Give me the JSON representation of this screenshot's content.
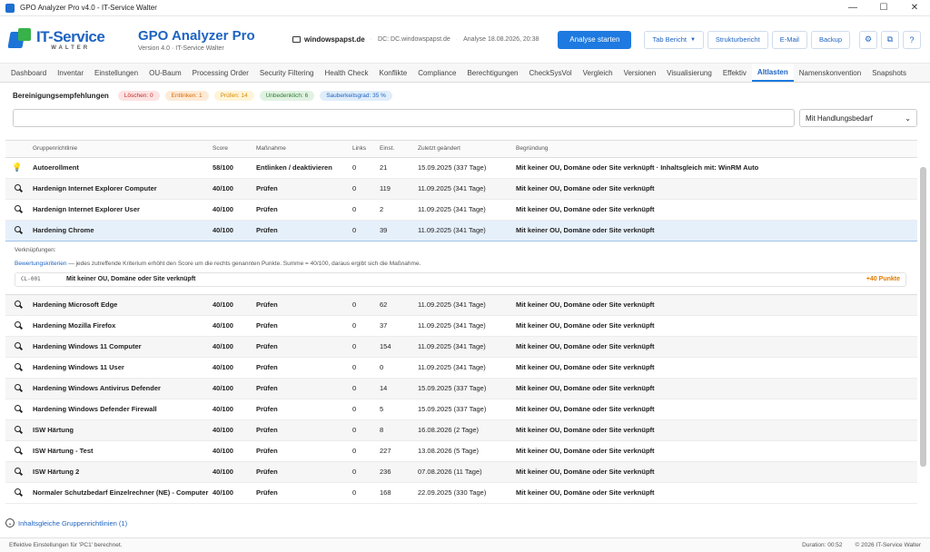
{
  "window": {
    "title": "GPO Analyzer Pro v4.0 - IT-Service Walter",
    "min": "—",
    "max": "☐",
    "close": "✕"
  },
  "brand": {
    "logo_line1": "IT-Service",
    "logo_line2": "WALTER",
    "product": "GPO Analyzer Pro",
    "version": "Version 4.0 · IT-Service Walter"
  },
  "context": {
    "host": "windowspapst.de",
    "dc": "DC: DC.windowspapst.de",
    "analysis": "Analyse 18.08.2026, 20:38"
  },
  "toolbar": {
    "start": "Analyse starten",
    "tab_report": "Tab Bericht",
    "structure": "Strukturbericht",
    "email": "E-Mail",
    "backup": "Backup",
    "help": "?"
  },
  "tabs": [
    "Dashboard",
    "Inventar",
    "Einstellungen",
    "OU-Baum",
    "Processing Order",
    "Security Filtering",
    "Health Check",
    "Konflikte",
    "Compliance",
    "Berechtigungen",
    "CheckSysVol",
    "Vergleich",
    "Versionen",
    "Visualisierung",
    "Effektiv",
    "Altlasten",
    "Namenskonvention",
    "Snapshots"
  ],
  "active_tab": "Altlasten",
  "cleanup": {
    "title": "Bereinigungsempfehlungen",
    "pills": [
      "Löschen: 0",
      "Entlinken: 1",
      "Prüfen: 14",
      "Unbedenklich: 6",
      "Sauberkeitsgrad: 35 %"
    ]
  },
  "filter": {
    "search_value": "",
    "select_value": "Mit Handlungsbedarf"
  },
  "table": {
    "headers": [
      "",
      "Gruppenrichtlinie",
      "Score",
      "Maßnahme",
      "Links",
      "Einst.",
      "Zuletzt geändert",
      "Begründung"
    ],
    "rows": [
      {
        "icon": "bulb",
        "name": "Autoerollment",
        "score": "58/100",
        "action": "Entlinken / deaktivieren",
        "links": "0",
        "settings": "21",
        "changed": "15.09.2025 (337 Tage)",
        "reason": "Mit keiner OU, Domäne oder Site verknüpft · Inhaltsgleich mit: WinRM Auto"
      },
      {
        "icon": "magnifier",
        "name": "Hardenign Internet Explorer Computer",
        "score": "40/100",
        "action": "Prüfen",
        "links": "0",
        "settings": "119",
        "changed": "11.09.2025 (341 Tage)",
        "reason": "Mit keiner OU, Domäne oder Site verknüpft"
      },
      {
        "icon": "magnifier",
        "name": "Hardenign Internet Explorer User",
        "score": "40/100",
        "action": "Prüfen",
        "links": "0",
        "settings": "2",
        "changed": "11.09.2025 (341 Tage)",
        "reason": "Mit keiner OU, Domäne oder Site verknüpft"
      },
      {
        "icon": "magnifier",
        "name": "Hardening Chrome",
        "score": "40/100",
        "action": "Prüfen",
        "links": "0",
        "settings": "39",
        "changed": "11.09.2025 (341 Tage)",
        "reason": "Mit keiner OU, Domäne oder Site verknüpft"
      },
      {
        "icon": "magnifier",
        "name": "Hardening Microsoft Edge",
        "score": "40/100",
        "action": "Prüfen",
        "links": "0",
        "settings": "62",
        "changed": "11.09.2025 (341 Tage)",
        "reason": "Mit keiner OU, Domäne oder Site verknüpft"
      },
      {
        "icon": "magnifier",
        "name": "Hardening Mozilla Firefox",
        "score": "40/100",
        "action": "Prüfen",
        "links": "0",
        "settings": "37",
        "changed": "11.09.2025 (341 Tage)",
        "reason": "Mit keiner OU, Domäne oder Site verknüpft"
      },
      {
        "icon": "magnifier",
        "name": "Hardening Windows 11 Computer",
        "score": "40/100",
        "action": "Prüfen",
        "links": "0",
        "settings": "154",
        "changed": "11.09.2025 (341 Tage)",
        "reason": "Mit keiner OU, Domäne oder Site verknüpft"
      },
      {
        "icon": "magnifier",
        "name": "Hardening Windows 11 User",
        "score": "40/100",
        "action": "Prüfen",
        "links": "0",
        "settings": "0",
        "changed": "11.09.2025 (341 Tage)",
        "reason": "Mit keiner OU, Domäne oder Site verknüpft"
      },
      {
        "icon": "magnifier",
        "name": "Hardening Windows Antivirus Defender",
        "score": "40/100",
        "action": "Prüfen",
        "links": "0",
        "settings": "14",
        "changed": "15.09.2025 (337 Tage)",
        "reason": "Mit keiner OU, Domäne oder Site verknüpft"
      },
      {
        "icon": "magnifier",
        "name": "Hardening Windows Defender Firewall",
        "score": "40/100",
        "action": "Prüfen",
        "links": "0",
        "settings": "5",
        "changed": "15.09.2025 (337 Tage)",
        "reason": "Mit keiner OU, Domäne oder Site verknüpft"
      },
      {
        "icon": "magnifier",
        "name": "ISW Härtung",
        "score": "40/100",
        "action": "Prüfen",
        "links": "0",
        "settings": "8",
        "changed": "16.08.2026 (2 Tage)",
        "reason": "Mit keiner OU, Domäne oder Site verknüpft"
      },
      {
        "icon": "magnifier",
        "name": "ISW Härtung - Test",
        "score": "40/100",
        "action": "Prüfen",
        "links": "0",
        "settings": "227",
        "changed": "13.08.2026 (5 Tage)",
        "reason": "Mit keiner OU, Domäne oder Site verknüpft"
      },
      {
        "icon": "magnifier",
        "name": "ISW Härtung 2",
        "score": "40/100",
        "action": "Prüfen",
        "links": "0",
        "settings": "236",
        "changed": "07.08.2026 (11 Tage)",
        "reason": "Mit keiner OU, Domäne oder Site verknüpft"
      },
      {
        "icon": "magnifier",
        "name": "Normaler Schutzbedarf Einzelrechner (NE) - Computer",
        "score": "40/100",
        "action": "Prüfen",
        "links": "0",
        "settings": "168",
        "changed": "22.09.2025 (330 Tage)",
        "reason": "Mit keiner OU, Domäne oder Site verknüpft"
      }
    ],
    "selected_index": 3
  },
  "detail": {
    "links_label": "Verknüpfungen:",
    "criteria_link": "Bewertungskriterien",
    "criteria_text": " — jedes zutreffende Kriterium erhöht den Score um die rechts genannten Punkte. Summe = 40/100, daraus ergibt sich die Maßnahme.",
    "criterion": {
      "id": "CL-001",
      "text": "Mit keiner OU, Domäne oder Site verknüpft",
      "points": "+40 Punkte"
    }
  },
  "collapse": {
    "label": "Inhaltsgleiche Gruppenrichtlinien (1)"
  },
  "status": {
    "left": "Effektive Einstellungen für 'PC1' berechnet.",
    "duration": "Duration: 00:52",
    "copyright": "© 2026 IT-Service Walter"
  }
}
